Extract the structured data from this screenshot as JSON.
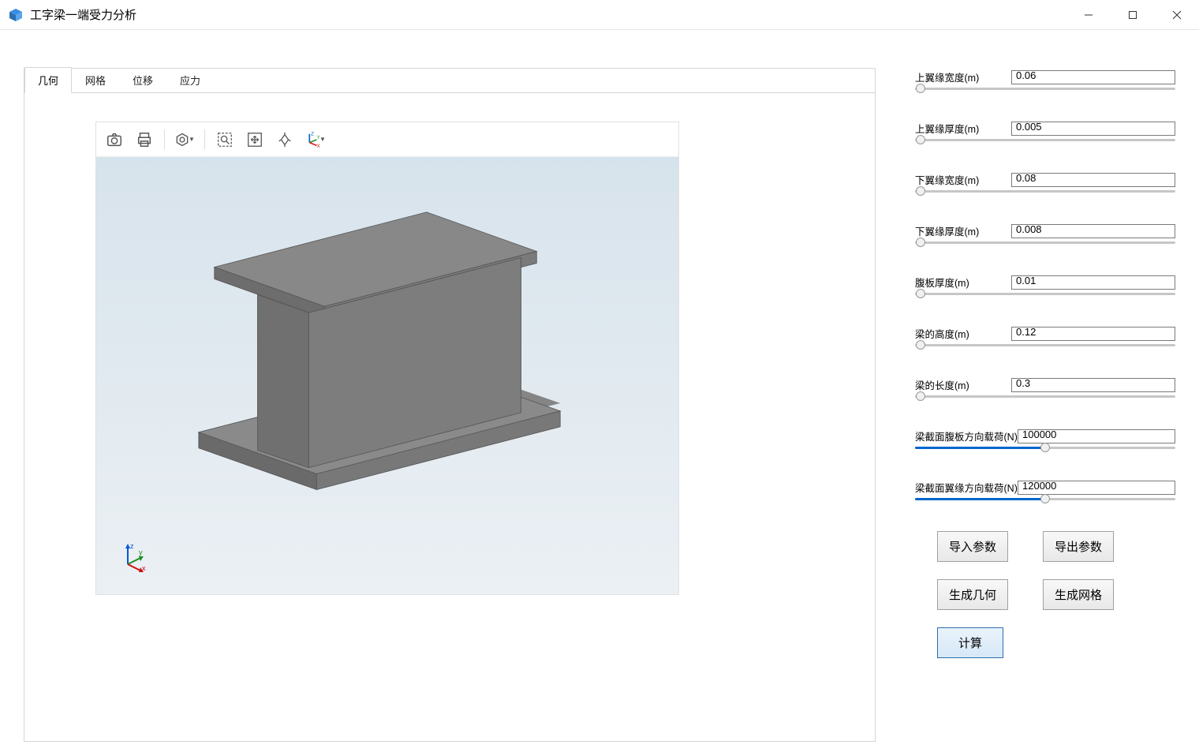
{
  "titlebar": {
    "title": "工字梁一端受力分析"
  },
  "tabs": [
    {
      "label": "几何",
      "active": true
    },
    {
      "label": "网格"
    },
    {
      "label": "位移"
    },
    {
      "label": "应力"
    }
  ],
  "toolbar_icons": {
    "camera": "camera-icon",
    "print": "print-icon",
    "nut": "nut-icon",
    "zoom_region": "zoom-region-icon",
    "fit": "fit-view-icon",
    "rotate": "rotate-icon",
    "axes": "axes-icon"
  },
  "params": [
    {
      "label": "上翼缘宽度(m)",
      "value": "0.06",
      "pos": 2
    },
    {
      "label": "上翼缘厚度(m)",
      "value": "0.005",
      "pos": 2
    },
    {
      "label": "下翼缘宽度(m)",
      "value": "0.08",
      "pos": 2
    },
    {
      "label": "下翼缘厚度(m)",
      "value": "0.008",
      "pos": 2
    },
    {
      "label": "腹板厚度(m)",
      "value": "0.01",
      "pos": 2
    },
    {
      "label": "梁的高度(m)",
      "value": "0.12",
      "pos": 2
    },
    {
      "label": "梁的长度(m)",
      "value": "0.3",
      "pos": 2
    },
    {
      "label": "梁截面腹板方向载荷(N)",
      "value": "100000",
      "pos": 50,
      "filled": true
    },
    {
      "label": "梁截面翼缘方向载荷(N)",
      "value": "120000",
      "pos": 50,
      "filled": true
    }
  ],
  "buttons": {
    "import": "导入参数",
    "export": "导出参数",
    "gen_geom": "生成几何",
    "gen_mesh": "生成网格",
    "compute": "计算"
  }
}
